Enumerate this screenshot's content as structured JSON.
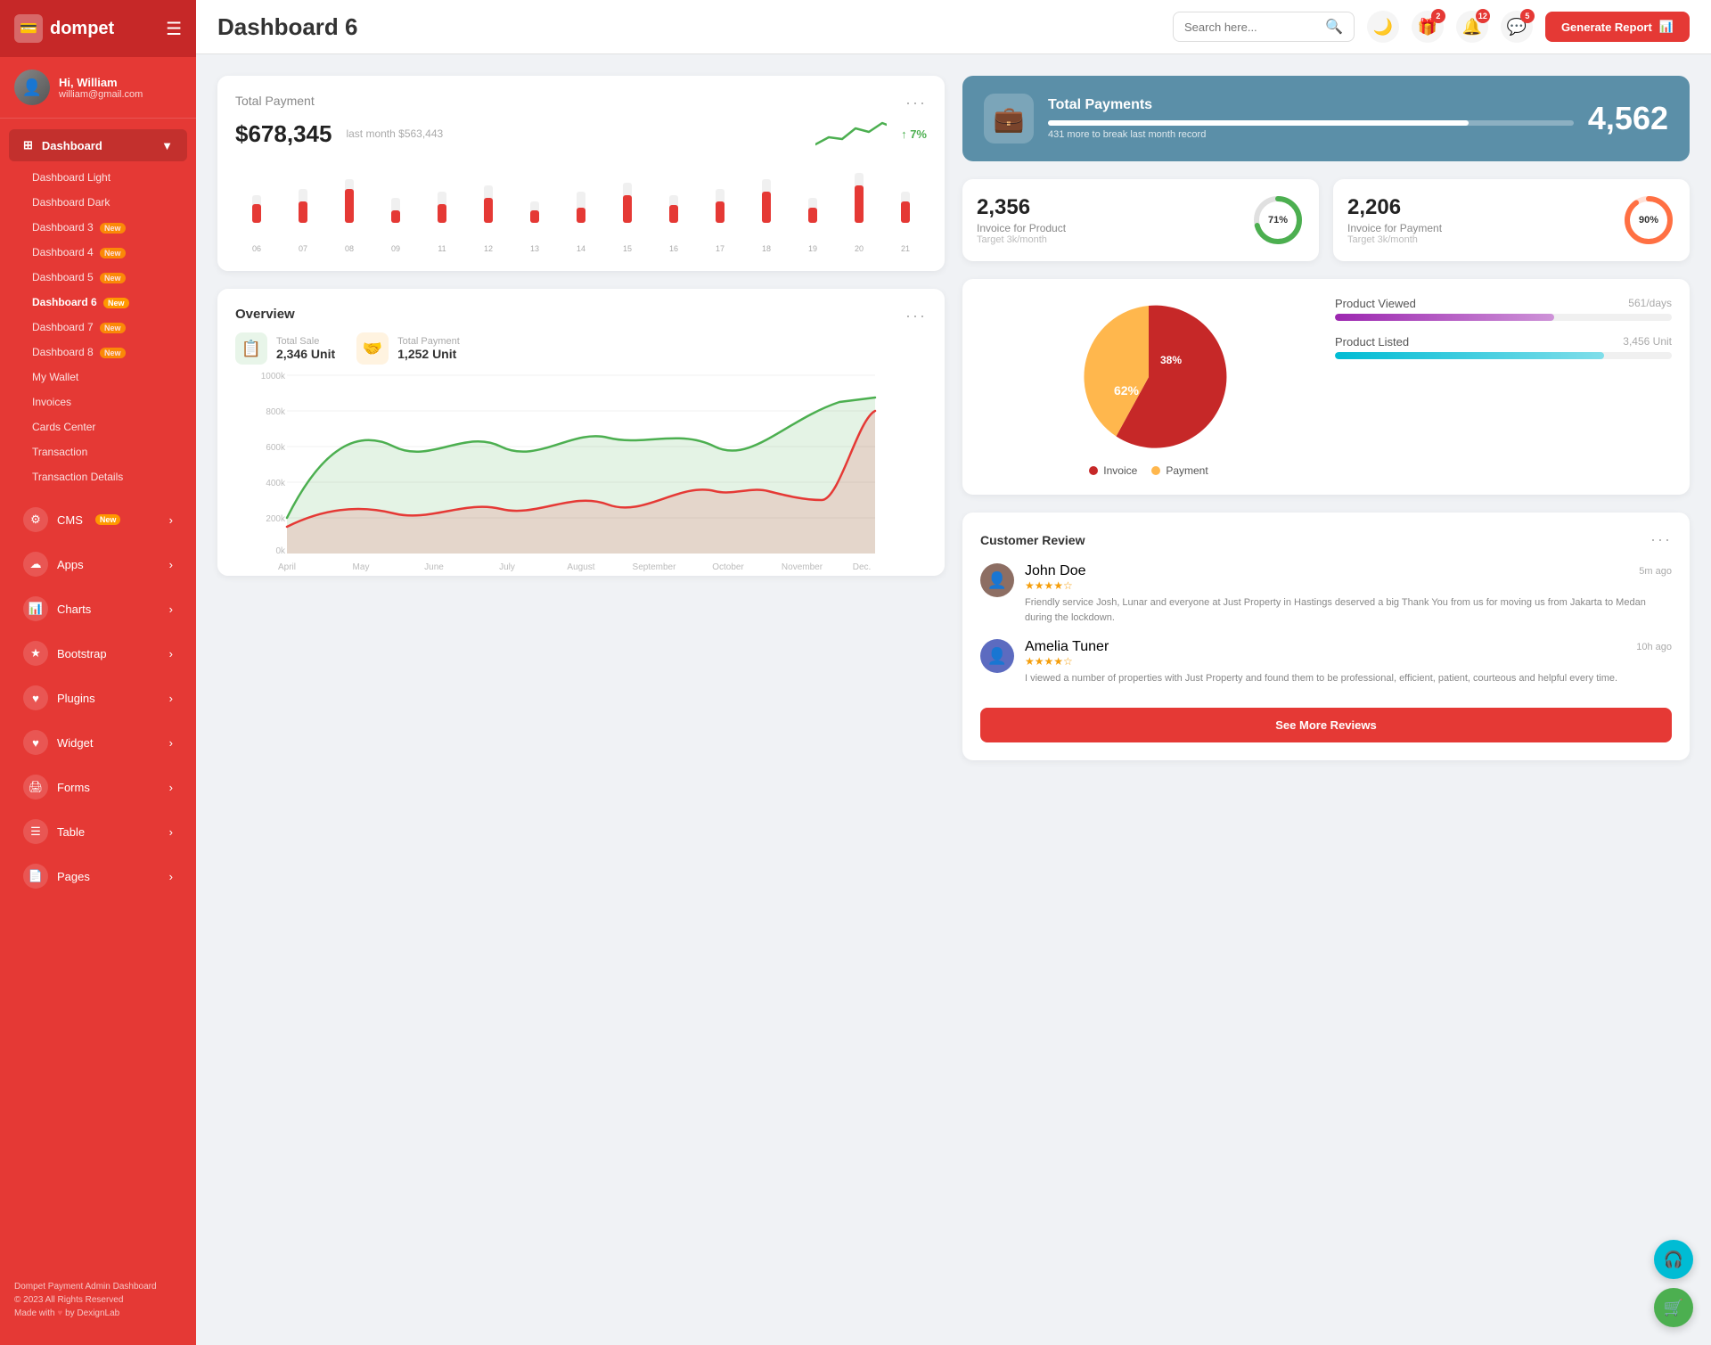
{
  "sidebar": {
    "logo": "dompet",
    "logo_icon": "💳",
    "hamburger": "☰",
    "user": {
      "greeting": "Hi, William",
      "email": "william@gmail.com",
      "avatar_text": "👤"
    },
    "nav_main": {
      "label": "Dashboard",
      "icon": "⊞",
      "arrow": "▼"
    },
    "sub_items": [
      {
        "label": "Dashboard Light",
        "badge": ""
      },
      {
        "label": "Dashboard Dark",
        "badge": ""
      },
      {
        "label": "Dashboard 3",
        "badge": "New"
      },
      {
        "label": "Dashboard 4",
        "badge": "New"
      },
      {
        "label": "Dashboard 5",
        "badge": "New"
      },
      {
        "label": "Dashboard 6",
        "badge": "New",
        "active": true
      },
      {
        "label": "Dashboard 7",
        "badge": "New"
      },
      {
        "label": "Dashboard 8",
        "badge": "New"
      },
      {
        "label": "My Wallet",
        "badge": ""
      },
      {
        "label": "Invoices",
        "badge": ""
      },
      {
        "label": "Cards Center",
        "badge": ""
      },
      {
        "label": "Transaction",
        "badge": ""
      },
      {
        "label": "Transaction Details",
        "badge": ""
      }
    ],
    "other_items": [
      {
        "label": "CMS",
        "icon": "⚙",
        "badge": "New",
        "arrow": "›"
      },
      {
        "label": "Apps",
        "icon": "☁",
        "arrow": "›"
      },
      {
        "label": "Charts",
        "icon": "📊",
        "arrow": "›"
      },
      {
        "label": "Bootstrap",
        "icon": "★",
        "arrow": "›"
      },
      {
        "label": "Plugins",
        "icon": "♥",
        "arrow": "›"
      },
      {
        "label": "Widget",
        "icon": "♥",
        "arrow": "›"
      },
      {
        "label": "Forms",
        "icon": "🖨",
        "arrow": "›"
      },
      {
        "label": "Table",
        "icon": "☰",
        "arrow": "›"
      },
      {
        "label": "Pages",
        "icon": "📄",
        "arrow": "›"
      }
    ],
    "footer_line1": "Dompet Payment Admin Dashboard",
    "footer_line2": "© 2023 All Rights Reserved",
    "footer_line3": "Made with ♥ by DexignLab"
  },
  "topbar": {
    "title": "Dashboard 6",
    "search_placeholder": "Search here...",
    "search_icon": "🔍",
    "moon_icon": "🌙",
    "gift_icon": "🎁",
    "gift_badge": "2",
    "bell_icon": "🔔",
    "bell_badge": "12",
    "chat_icon": "💬",
    "chat_badge": "5",
    "generate_btn": "Generate Report",
    "chart_icon": "📊"
  },
  "total_payment": {
    "title": "Total Payment",
    "amount": "$678,345",
    "last_month": "last month $563,443",
    "trend": "7%",
    "dots": "···",
    "bars": [
      {
        "label": "06",
        "height_pct": 45,
        "red_pct": 30
      },
      {
        "label": "07",
        "height_pct": 55,
        "red_pct": 35
      },
      {
        "label": "08",
        "height_pct": 70,
        "red_pct": 55
      },
      {
        "label": "09",
        "height_pct": 40,
        "red_pct": 20
      },
      {
        "label": "11",
        "height_pct": 50,
        "red_pct": 30
      },
      {
        "label": "12",
        "height_pct": 60,
        "red_pct": 40
      },
      {
        "label": "13",
        "height_pct": 35,
        "red_pct": 20
      },
      {
        "label": "14",
        "height_pct": 50,
        "red_pct": 25
      },
      {
        "label": "15",
        "height_pct": 65,
        "red_pct": 45
      },
      {
        "label": "16",
        "height_pct": 45,
        "red_pct": 28
      },
      {
        "label": "17",
        "height_pct": 55,
        "red_pct": 35
      },
      {
        "label": "18",
        "height_pct": 70,
        "red_pct": 50
      },
      {
        "label": "19",
        "height_pct": 40,
        "red_pct": 25
      },
      {
        "label": "20",
        "height_pct": 80,
        "red_pct": 60
      },
      {
        "label": "21",
        "height_pct": 50,
        "red_pct": 35
      }
    ]
  },
  "total_payments_blue": {
    "title": "Total Payments",
    "subtitle": "431 more to break last month record",
    "number": "4,562",
    "bar_pct": 80,
    "icon": "💼"
  },
  "invoice_product": {
    "number": "2,356",
    "label": "Invoice for Product",
    "target": "Target 3k/month",
    "pct": 71,
    "color": "#4caf50"
  },
  "invoice_payment": {
    "number": "2,206",
    "label": "Invoice for Payment",
    "target": "Target 3k/month",
    "pct": 90,
    "color": "#ff7043"
  },
  "overview": {
    "title": "Overview",
    "dots": "···",
    "total_sale": {
      "label": "Total Sale",
      "value": "2,346 Unit",
      "icon": "📋"
    },
    "total_payment": {
      "label": "Total Payment",
      "value": "1,252 Unit",
      "icon": "🤝"
    },
    "chart_labels": [
      "April",
      "May",
      "June",
      "July",
      "August",
      "September",
      "October",
      "November",
      "Dec."
    ],
    "chart_y_labels": [
      "1000k",
      "800k",
      "600k",
      "400k",
      "200k",
      "0k"
    ]
  },
  "pie_chart": {
    "invoice_pct": 62,
    "payment_pct": 38,
    "invoice_color": "#c62828",
    "payment_color": "#ffb74d",
    "legend_invoice": "Invoice",
    "legend_payment": "Payment"
  },
  "product_stats": {
    "viewed": {
      "label": "Product Viewed",
      "value": "561/days",
      "pct": 65,
      "color": "#9c27b0"
    },
    "listed": {
      "label": "Product Listed",
      "value": "3,456 Unit",
      "pct": 80,
      "color": "#00bcd4"
    }
  },
  "customer_review": {
    "title": "Customer Review",
    "dots": "···",
    "reviews": [
      {
        "name": "John Doe",
        "stars": 4,
        "time": "5m ago",
        "text": "Friendly service Josh, Lunar and everyone at Just Property in Hastings deserved a big Thank You from us for moving us from Jakarta to Medan during the lockdown.",
        "avatar_color": "#8d6e63"
      },
      {
        "name": "Amelia Tuner",
        "stars": 4,
        "time": "10h ago",
        "text": "I viewed a number of properties with Just Property and found them to be professional, efficient, patient, courteous and helpful every time.",
        "avatar_color": "#5c6bc0"
      }
    ],
    "see_more_btn": "See More Reviews"
  },
  "float_btns": {
    "headset_icon": "🎧",
    "cart_icon": "🛒"
  }
}
